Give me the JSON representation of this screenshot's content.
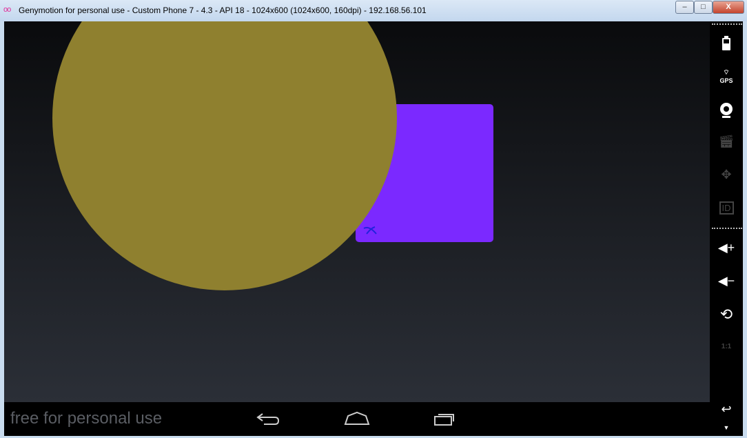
{
  "window": {
    "title": "Genymotion for personal use - Custom Phone 7 - 4.3 - API 18 - 1024x600 (1024x600, 160dpi) - 192.168.56.101",
    "minimize": "‒",
    "maximize": "□",
    "close": "X"
  },
  "colors": {
    "circle": "#8f802f",
    "rect": "#7b29ff",
    "mark": "#2222dd"
  },
  "navbar": {
    "watermark": "free for personal use"
  },
  "toolbar": {
    "gps": "GPS",
    "id": "ID",
    "ratio": "1:1"
  }
}
